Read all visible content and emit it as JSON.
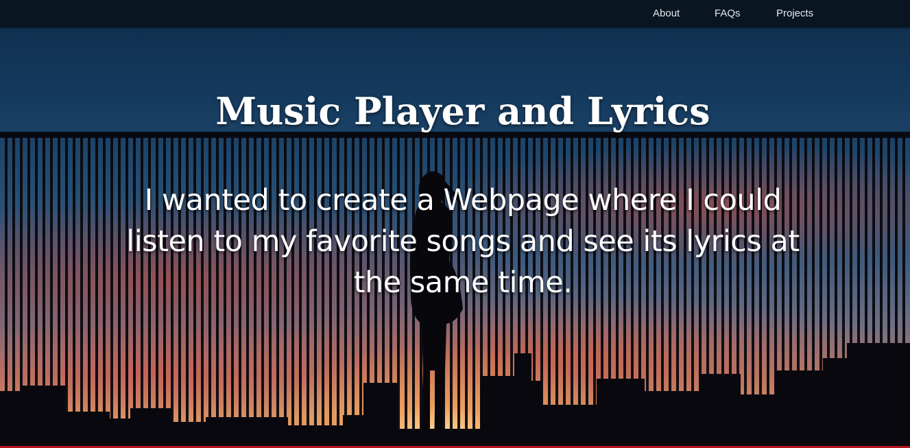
{
  "nav": {
    "links": [
      {
        "label": "About"
      },
      {
        "label": "FAQs"
      },
      {
        "label": "Projects"
      }
    ]
  },
  "hero": {
    "title": "Music Player and Lyrics",
    "description": "I wanted to create a Webpage where I could listen to my favorite songs and see its lyrics at the same time.",
    "image": "sunset-railing-silhouette"
  },
  "colors": {
    "navbar": "#091521",
    "text": "#ffffff",
    "accent_line": "#b3141c"
  }
}
